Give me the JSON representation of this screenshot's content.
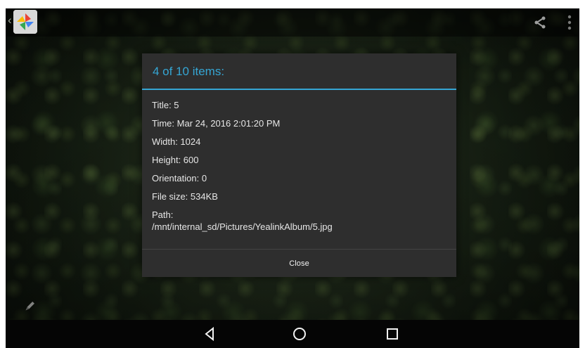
{
  "dialog": {
    "title": "4 of 10 items:",
    "details": [
      "Title: 5",
      "Time: Mar 24, 2016 2:01:20 PM",
      "Width: 1024",
      "Height: 600",
      "Orientation: 0",
      "File size: 534KB"
    ],
    "path_label": "Path:",
    "path_value": "/mnt/internal_sd/Pictures/YealinkAlbum/5.jpg",
    "close_label": "Close"
  },
  "toolbar": {
    "icons": [
      "back-chevron-icon",
      "app-icon",
      "share-icon",
      "overflow-menu-icon"
    ]
  },
  "bottom_nav": {
    "icons": [
      "back-icon",
      "home-icon",
      "recent-apps-icon"
    ]
  },
  "side_tool": {
    "icon": "edit-icon"
  },
  "colors": {
    "accent": "#35a6d4",
    "dialog_bg": "#2e2e2e",
    "navbar_bg": "#050505"
  }
}
